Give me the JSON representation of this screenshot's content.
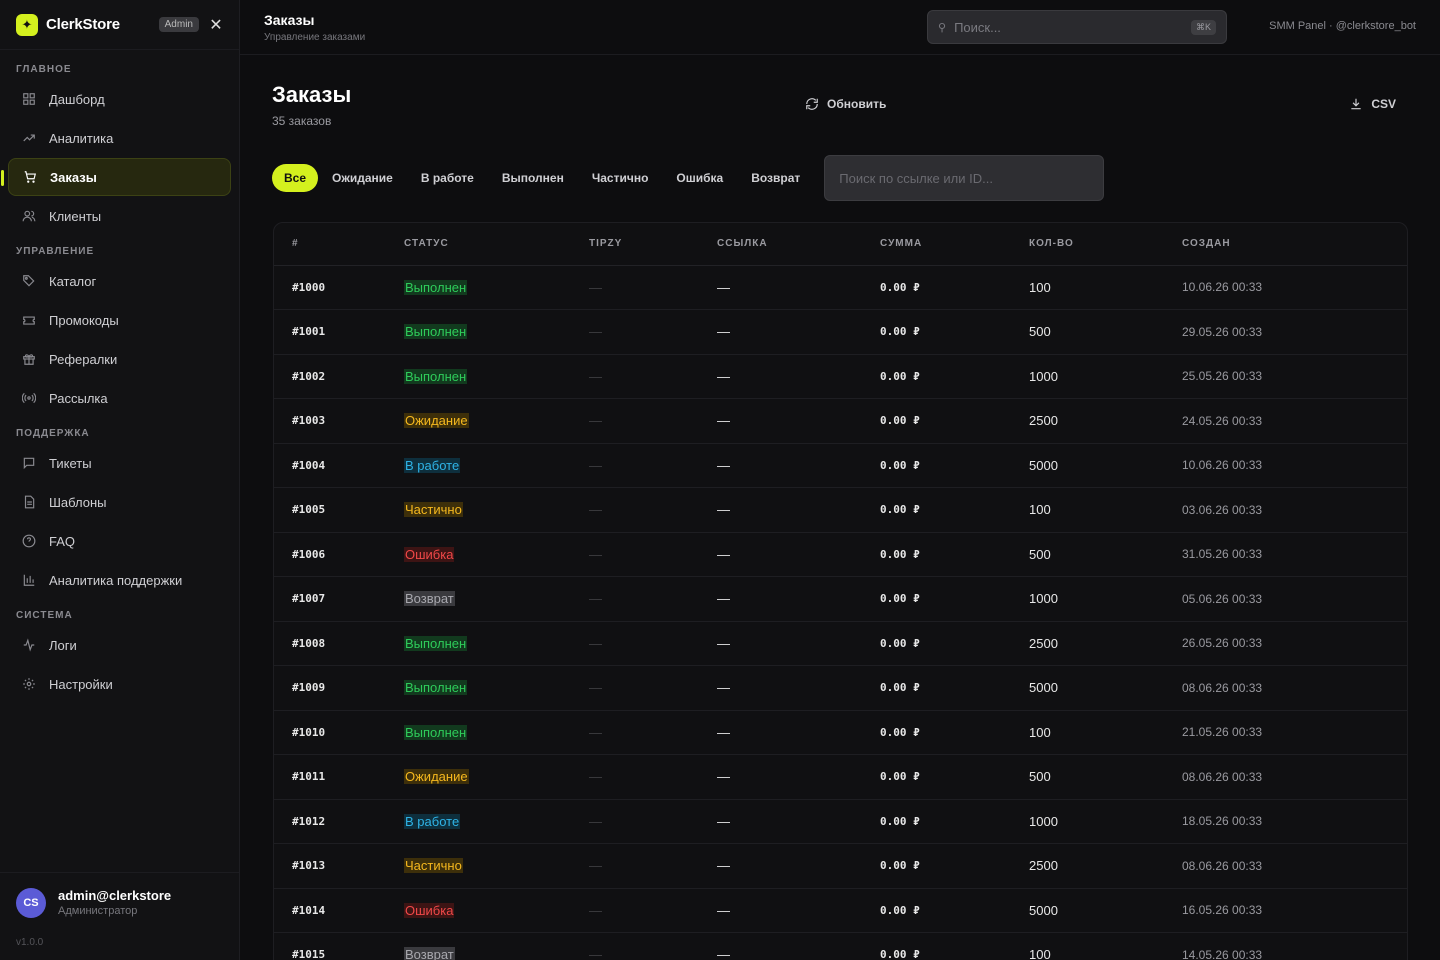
{
  "brand": {
    "name": "ClerkStore",
    "badge": "Admin",
    "logo_glyph": "✦"
  },
  "sidebar": {
    "sections": [
      {
        "title": "ГЛАВНОЕ",
        "items": [
          {
            "label": "Дашборд",
            "icon": "grid-icon"
          },
          {
            "label": "Аналитика",
            "icon": "trending-icon"
          },
          {
            "label": "Заказы",
            "icon": "cart-icon",
            "active": true
          },
          {
            "label": "Клиенты",
            "icon": "users-icon"
          }
        ]
      },
      {
        "title": "УПРАВЛЕНИЕ",
        "items": [
          {
            "label": "Каталог",
            "icon": "tag-icon"
          },
          {
            "label": "Промокоды",
            "icon": "ticket-icon"
          },
          {
            "label": "Рефералки",
            "icon": "gift-icon"
          },
          {
            "label": "Рассылка",
            "icon": "broadcast-icon"
          }
        ]
      },
      {
        "title": "ПОДДЕРЖКА",
        "items": [
          {
            "label": "Тикеты",
            "icon": "message-icon"
          },
          {
            "label": "Шаблоны",
            "icon": "file-icon"
          },
          {
            "label": "FAQ",
            "icon": "help-icon"
          },
          {
            "label": "Аналитика поддержки",
            "icon": "bar-chart-icon"
          }
        ]
      },
      {
        "title": "СИСТЕМА",
        "items": [
          {
            "label": "Логи",
            "icon": "activity-icon"
          },
          {
            "label": "Настройки",
            "icon": "gear-icon"
          }
        ]
      }
    ],
    "user": {
      "initials": "CS",
      "name": "admin@clerkstore",
      "role": "Администратор"
    },
    "version": "v1.0.0"
  },
  "topbar": {
    "title": "Заказы",
    "subtitle": "Управление заказами",
    "search_placeholder": "Поиск...",
    "shortcut": "⌘K",
    "right_text": "SMM Panel · @clerkstore_bot"
  },
  "page": {
    "title": "Заказы",
    "count": "35 заказов",
    "refresh_label": "Обновить",
    "csv_label": "CSV"
  },
  "filters": [
    "Все",
    "Ожидание",
    "В работе",
    "Выполнен",
    "Частично",
    "Ошибка",
    "Возврат"
  ],
  "active_filter": "Все",
  "filter_search_placeholder": "Поиск по ссылке или ID...",
  "table": {
    "columns": [
      "#",
      "СТАТУС",
      "TIPZY",
      "ССЫЛКА",
      "СУММА",
      "КОЛ-ВО",
      "СОЗДАН"
    ],
    "rows": [
      {
        "id": "#1000",
        "status": "Выполнен",
        "tipzy": "—",
        "link": "—",
        "sum": "0.00 ₽",
        "qty": "100",
        "created": "10.06.26 00:33"
      },
      {
        "id": "#1001",
        "status": "Выполнен",
        "tipzy": "—",
        "link": "—",
        "sum": "0.00 ₽",
        "qty": "500",
        "created": "29.05.26 00:33"
      },
      {
        "id": "#1002",
        "status": "Выполнен",
        "tipzy": "—",
        "link": "—",
        "sum": "0.00 ₽",
        "qty": "1000",
        "created": "25.05.26 00:33"
      },
      {
        "id": "#1003",
        "status": "Ожидание",
        "tipzy": "—",
        "link": "—",
        "sum": "0.00 ₽",
        "qty": "2500",
        "created": "24.05.26 00:33"
      },
      {
        "id": "#1004",
        "status": "В работе",
        "tipzy": "—",
        "link": "—",
        "sum": "0.00 ₽",
        "qty": "5000",
        "created": "10.06.26 00:33"
      },
      {
        "id": "#1005",
        "status": "Частично",
        "tipzy": "—",
        "link": "—",
        "sum": "0.00 ₽",
        "qty": "100",
        "created": "03.06.26 00:33"
      },
      {
        "id": "#1006",
        "status": "Ошибка",
        "tipzy": "—",
        "link": "—",
        "sum": "0.00 ₽",
        "qty": "500",
        "created": "31.05.26 00:33"
      },
      {
        "id": "#1007",
        "status": "Возврат",
        "tipzy": "—",
        "link": "—",
        "sum": "0.00 ₽",
        "qty": "1000",
        "created": "05.06.26 00:33"
      },
      {
        "id": "#1008",
        "status": "Выполнен",
        "tipzy": "—",
        "link": "—",
        "sum": "0.00 ₽",
        "qty": "2500",
        "created": "26.05.26 00:33"
      },
      {
        "id": "#1009",
        "status": "Выполнен",
        "tipzy": "—",
        "link": "—",
        "sum": "0.00 ₽",
        "qty": "5000",
        "created": "08.06.26 00:33"
      },
      {
        "id": "#1010",
        "status": "Выполнен",
        "tipzy": "—",
        "link": "—",
        "sum": "0.00 ₽",
        "qty": "100",
        "created": "21.05.26 00:33"
      },
      {
        "id": "#1011",
        "status": "Ожидание",
        "tipzy": "—",
        "link": "—",
        "sum": "0.00 ₽",
        "qty": "500",
        "created": "08.06.26 00:33"
      },
      {
        "id": "#1012",
        "status": "В работе",
        "tipzy": "—",
        "link": "—",
        "sum": "0.00 ₽",
        "qty": "1000",
        "created": "18.05.26 00:33"
      },
      {
        "id": "#1013",
        "status": "Частично",
        "tipzy": "—",
        "link": "—",
        "sum": "0.00 ₽",
        "qty": "2500",
        "created": "08.06.26 00:33"
      },
      {
        "id": "#1014",
        "status": "Ошибка",
        "tipzy": "—",
        "link": "—",
        "sum": "0.00 ₽",
        "qty": "5000",
        "created": "16.05.26 00:33"
      },
      {
        "id": "#1015",
        "status": "Возврат",
        "tipzy": "—",
        "link": "—",
        "sum": "0.00 ₽",
        "qty": "100",
        "created": "14.05.26 00:33"
      }
    ]
  },
  "status_colors": {
    "Выполнен": {
      "fg": "#2ecc5a",
      "bg": "#123a1e"
    },
    "Ожидание": {
      "fg": "#f5b81e",
      "bg": "#3d2f0a"
    },
    "В работе": {
      "fg": "#2fb3e6",
      "bg": "#0e2f3d"
    },
    "Частично": {
      "fg": "#f5b81e",
      "bg": "#3d2f0a"
    },
    "Ошибка": {
      "fg": "#f04848",
      "bg": "#3d1414"
    },
    "Возврат": {
      "fg": "#a8a8ae",
      "bg": "#3a3a3e"
    }
  },
  "accent": "#d4f01e"
}
